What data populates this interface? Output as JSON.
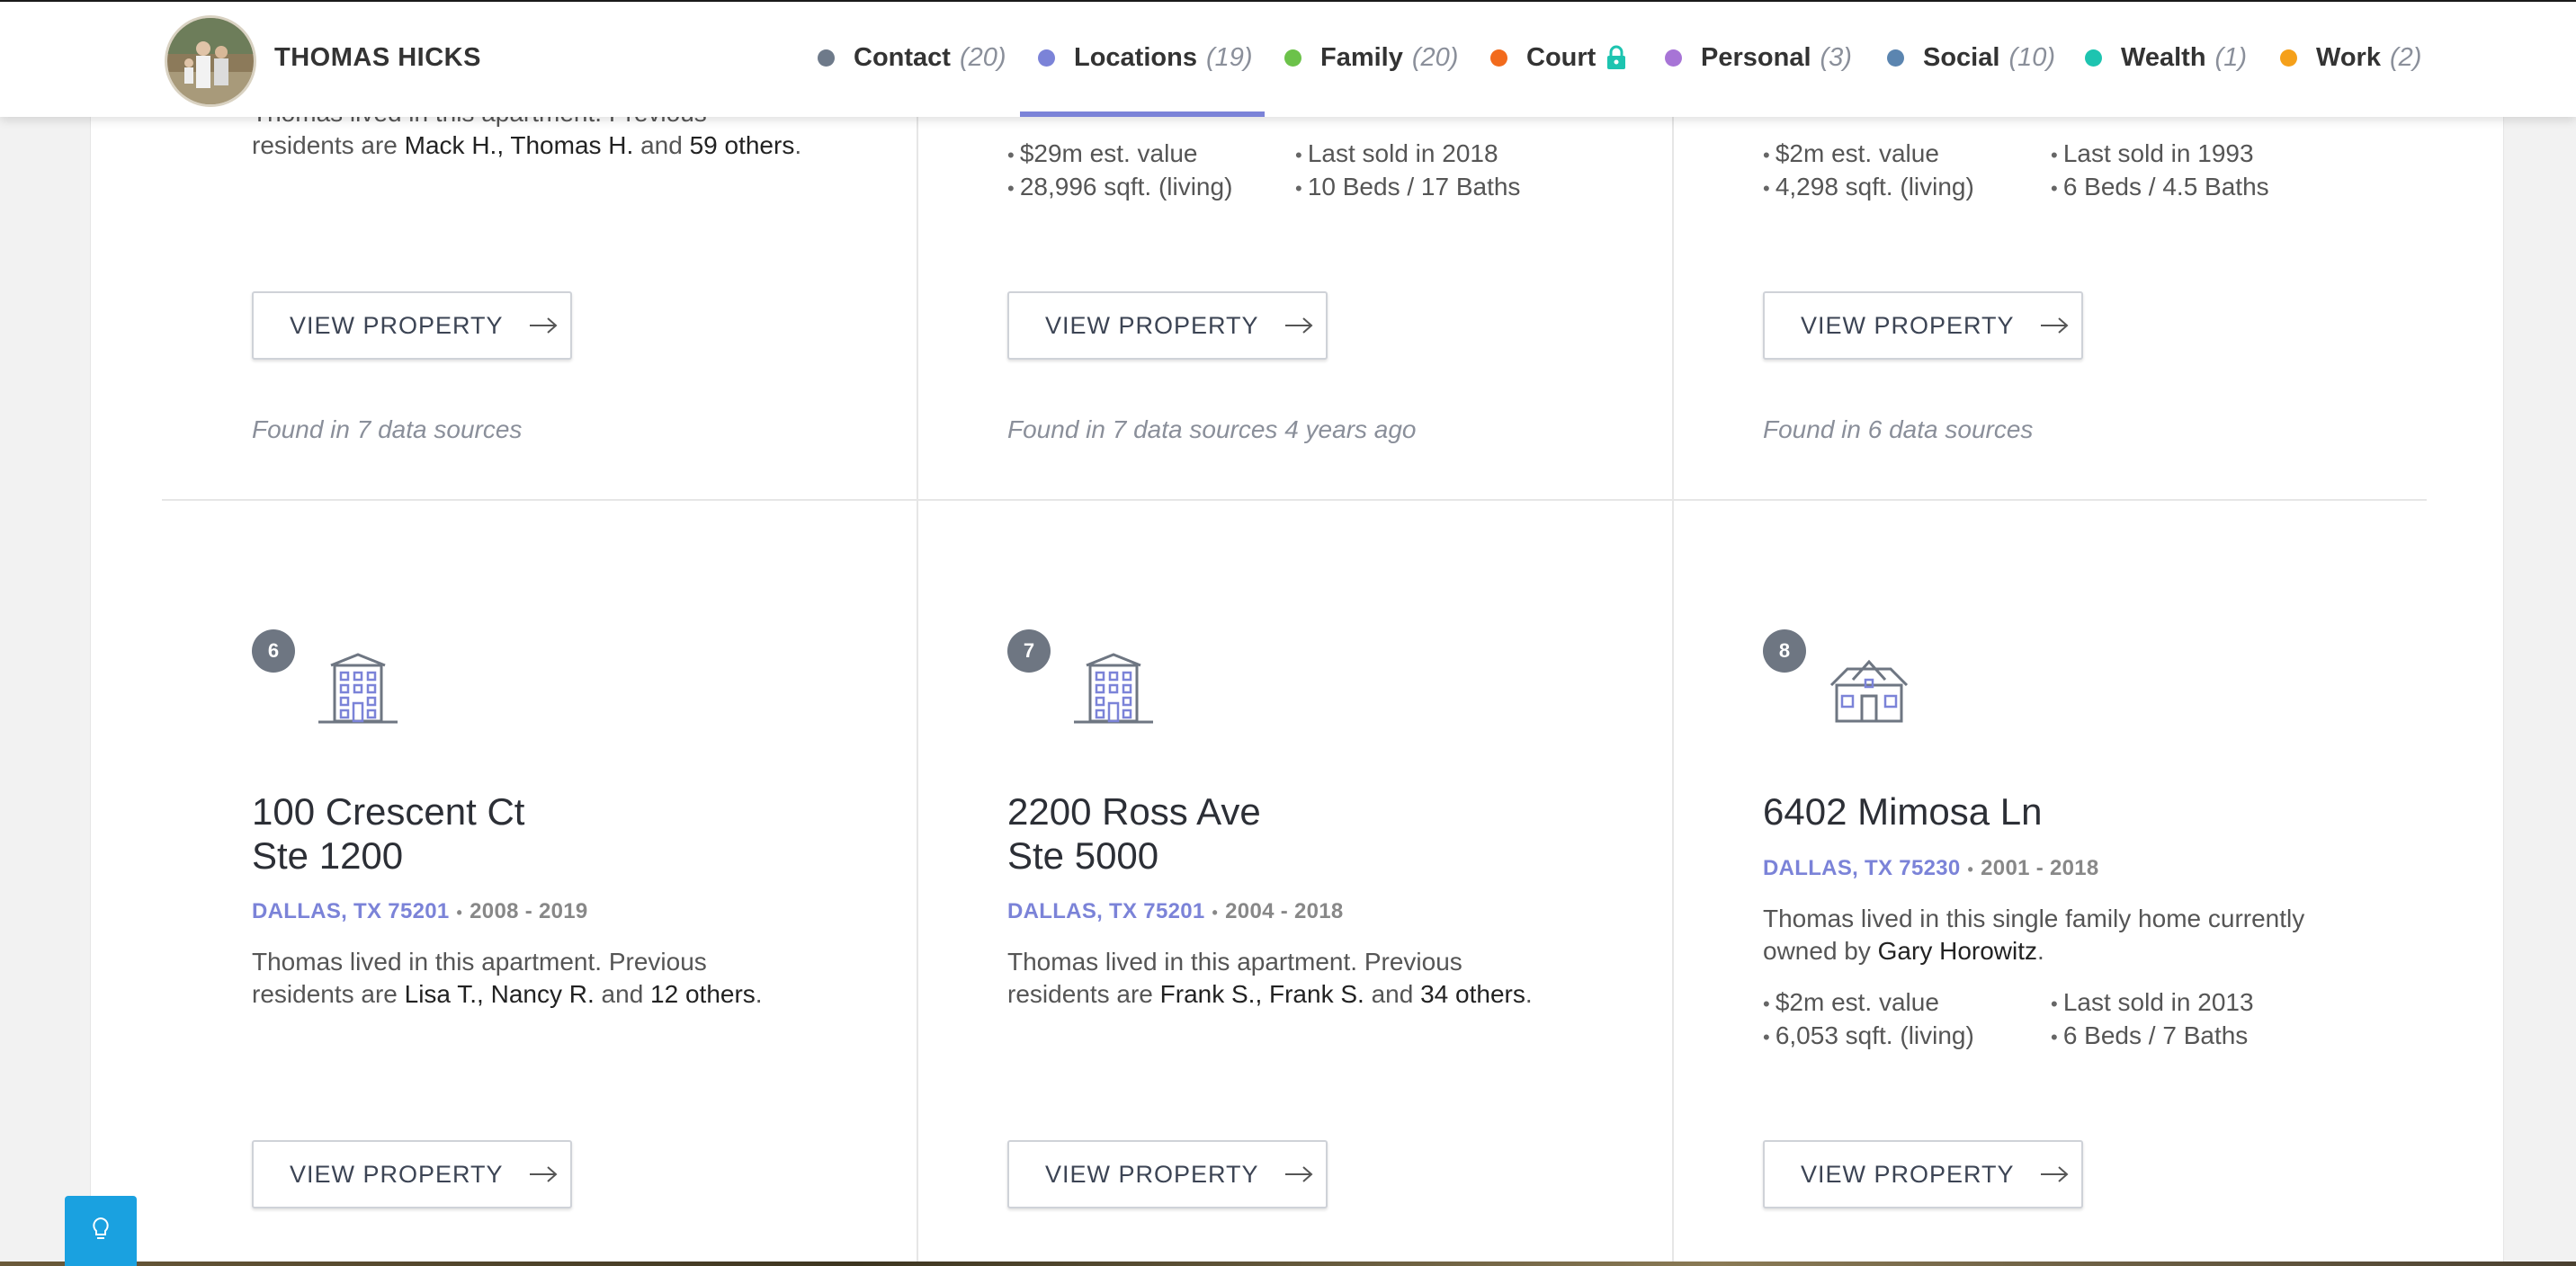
{
  "profile": {
    "name": "THOMAS HICKS"
  },
  "nav": {
    "tabs": [
      {
        "label": "Contact",
        "count": "(20)",
        "color": "#6e7a8a"
      },
      {
        "label": "Locations",
        "count": "(19)",
        "color": "#7b83d8",
        "active": true
      },
      {
        "label": "Family",
        "count": "(20)",
        "color": "#6cc24a"
      },
      {
        "label": "Court",
        "count": "",
        "color": "#f26b1d",
        "locked": true
      },
      {
        "label": "Personal",
        "count": "(3)",
        "color": "#a774d6"
      },
      {
        "label": "Social",
        "count": "(10)",
        "color": "#5b85b0"
      },
      {
        "label": "Wealth",
        "count": "(1)",
        "color": "#1dc4b0"
      },
      {
        "label": "Work",
        "count": "(2)",
        "color": "#f5a01a"
      }
    ]
  },
  "top_row": [
    {
      "desc_cut": "Thomas lived in this apartment. Previous",
      "desc_pre": "residents are ",
      "names": "Mack H., Thomas H.",
      "and": " and ",
      "others": "59 others",
      "period": ".",
      "button": "VIEW PROPERTY",
      "found": "Found in 7 data sources"
    },
    {
      "facts": [
        "$29m est. value",
        "Last sold in 2018",
        "28,996 sqft. (living)",
        "10 Beds / 17 Baths"
      ],
      "button": "VIEW PROPERTY",
      "found": "Found in 7 data sources 4 years ago"
    },
    {
      "facts": [
        "$2m est. value",
        "Last sold in 1993",
        "4,298 sqft. (living)",
        "6 Beds / 4.5 Baths"
      ],
      "button": "VIEW PROPERTY",
      "found": "Found in 6 data sources"
    }
  ],
  "bottom_row": [
    {
      "num": "6",
      "icon": "apartment-building-icon",
      "addr1": "100 Crescent Ct",
      "addr2": "Ste 1200",
      "city": "DALLAS, TX 75201",
      "years": "2008 - 2019",
      "desc_a": "Thomas lived in this apartment. Previous",
      "desc_pre": "residents are ",
      "names": "Lisa T., Nancy R.",
      "and": " and ",
      "others": "12 others",
      "period": ".",
      "button": "VIEW PROPERTY"
    },
    {
      "num": "7",
      "icon": "apartment-building-icon",
      "addr1": "2200 Ross Ave",
      "addr2": "Ste 5000",
      "city": "DALLAS, TX 75201",
      "years": "2004 - 2018",
      "desc_a": "Thomas lived in this apartment. Previous",
      "desc_pre": "residents are ",
      "names": "Frank S., Frank S.",
      "and": " and ",
      "others": "34 others",
      "period": ".",
      "button": "VIEW PROPERTY"
    },
    {
      "num": "8",
      "icon": "house-icon",
      "addr1": "6402 Mimosa Ln",
      "city": "DALLAS, TX 75230",
      "years": "2001 - 2018",
      "desc_a": "Thomas lived in this single family home currently",
      "desc_pre": "owned by ",
      "owner": "Gary Horowitz",
      "period": ".",
      "facts": [
        "$2m est. value",
        "Last sold in 2013",
        "6,053 sqft. (living)",
        "6 Beds / 7 Baths"
      ],
      "button": "VIEW PROPERTY"
    }
  ],
  "tip_button": {
    "icon": "lightbulb-icon"
  }
}
